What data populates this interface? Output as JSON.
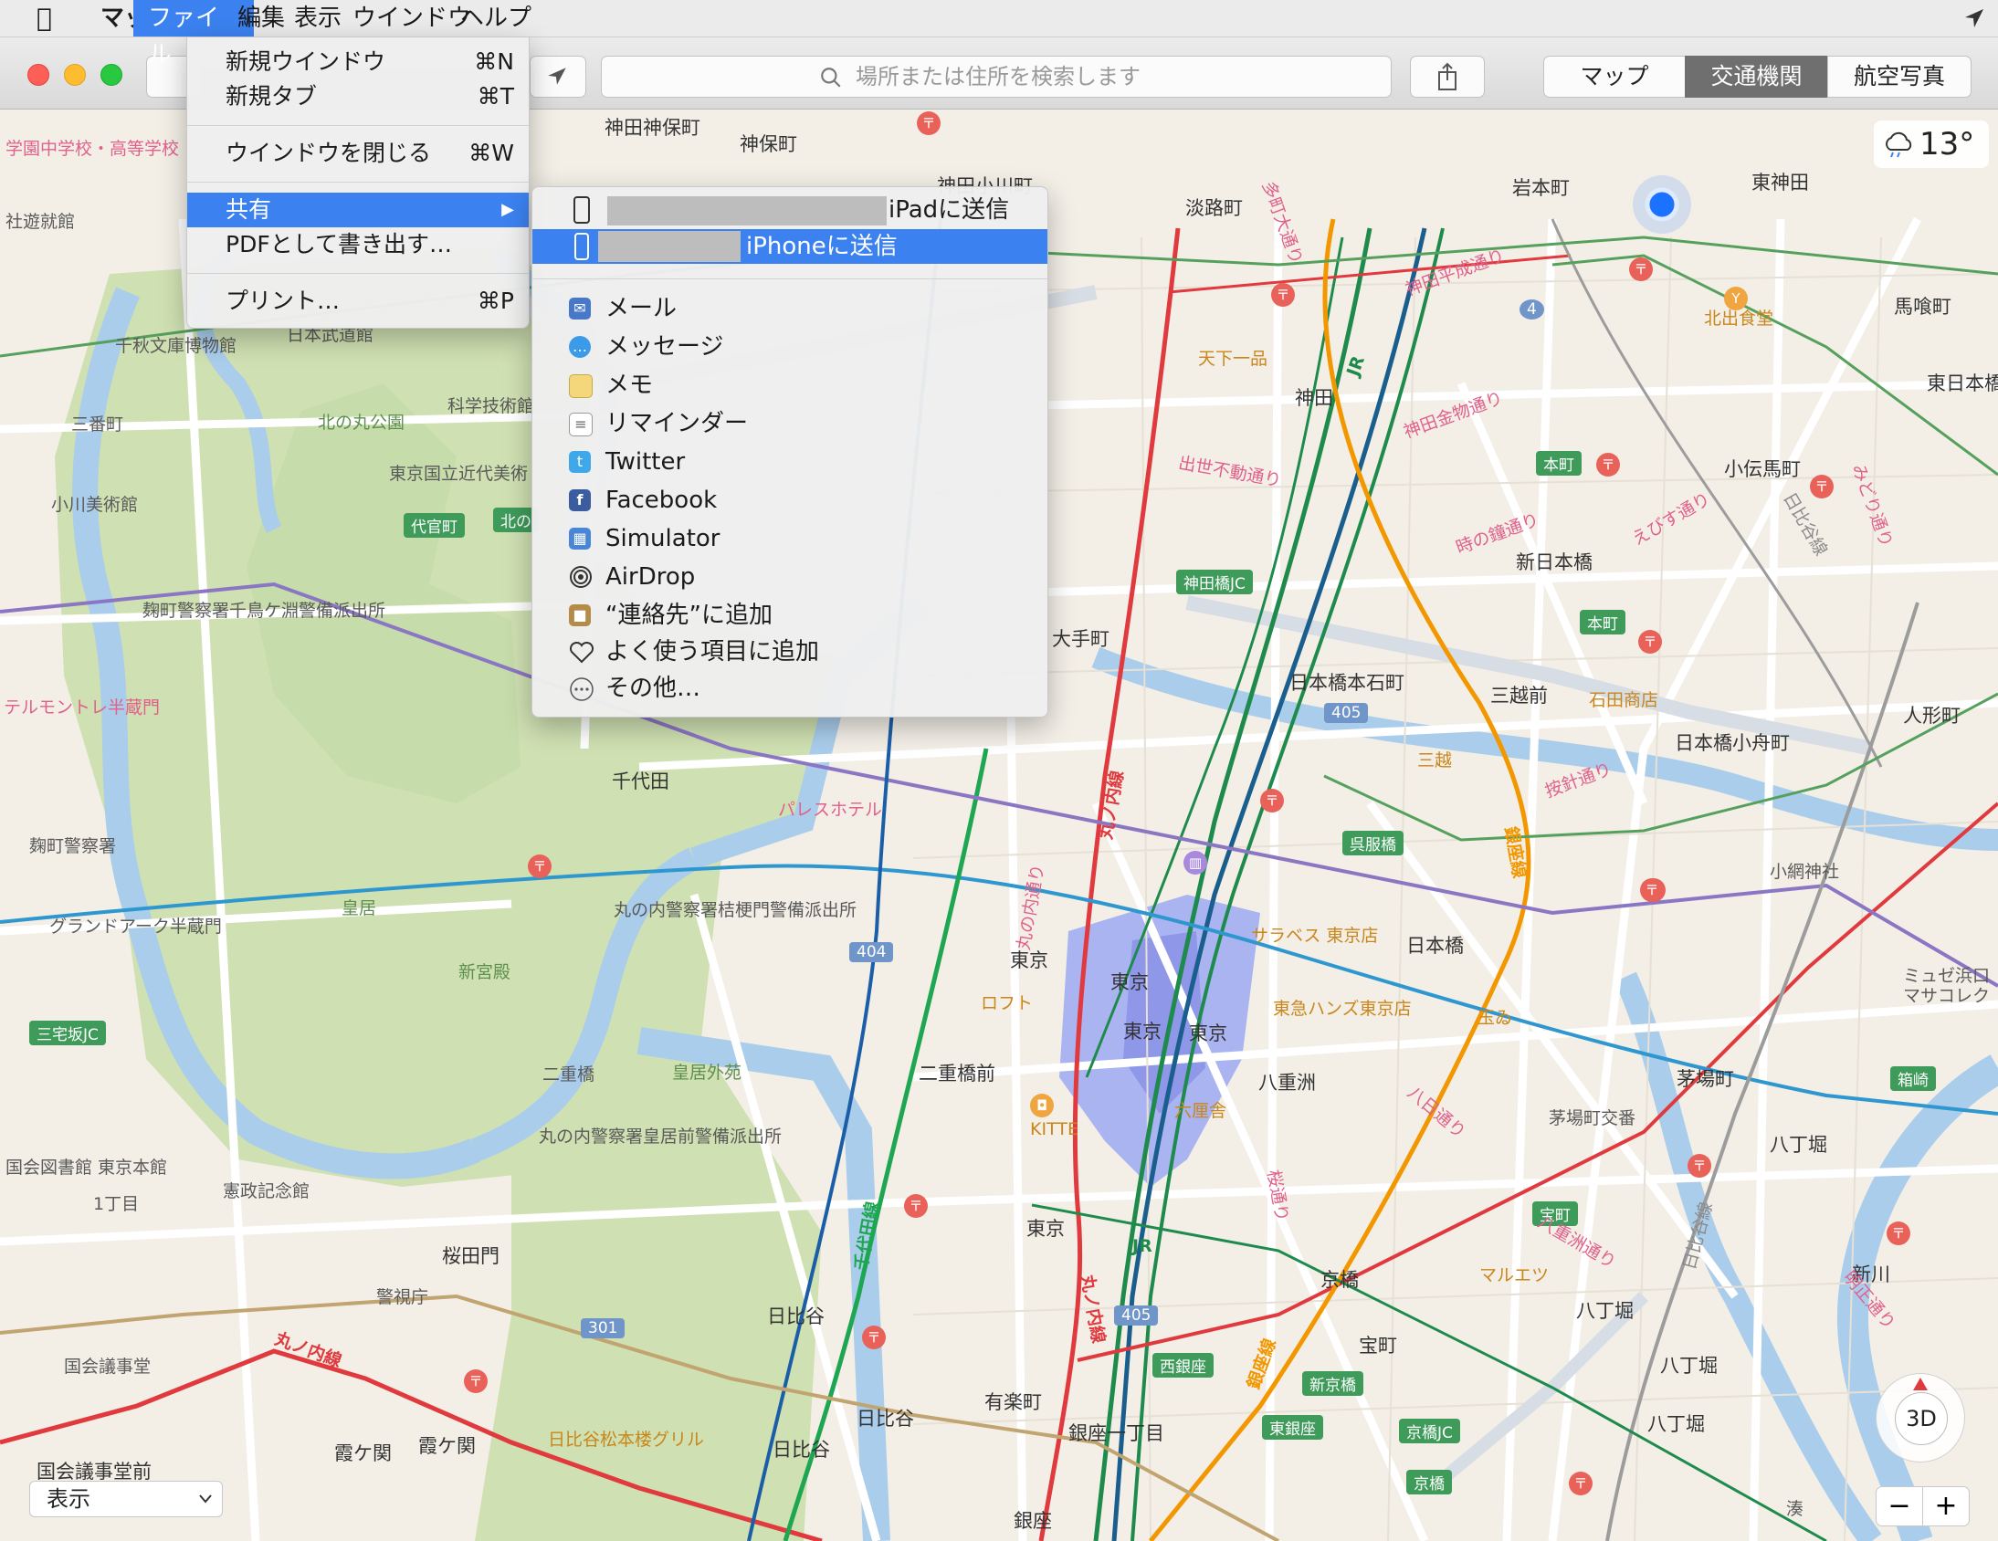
{
  "menubar": {
    "apple": "",
    "items": [
      "マップ",
      "ファイル",
      "編集",
      "表示",
      "ウインドウ",
      "ヘルプ"
    ],
    "status_icon": "location-arrow"
  },
  "toolbar": {
    "search_placeholder": "場所または住所を検索します",
    "segments": [
      "マップ",
      "交通機関",
      "航空写真"
    ],
    "selected_segment": "交通機関"
  },
  "weather": {
    "temp": "13°"
  },
  "file_menu": {
    "items": [
      {
        "label": "新規ウインドウ",
        "shortcut": "⌘N"
      },
      {
        "label": "新規タブ",
        "shortcut": "⌘T"
      },
      {
        "label": "ウインドウを閉じる",
        "shortcut": "⌘W"
      },
      {
        "label": "共有",
        "shortcut": "▶"
      },
      {
        "label": "PDFとして書き出す…",
        "shortcut": ""
      },
      {
        "label": "プリント…",
        "shortcut": "⌘P"
      }
    ]
  },
  "share_menu": {
    "ipad": "iPadに送信",
    "iphone": "iPhoneに送信",
    "items": [
      {
        "label": "メール",
        "icon": "mail-icon",
        "color": "#4a78c8"
      },
      {
        "label": "メッセージ",
        "icon": "messages-icon",
        "color": "#3c9be8"
      },
      {
        "label": "メモ",
        "icon": "notes-icon",
        "color": "#f3d77a"
      },
      {
        "label": "リマインダー",
        "icon": "reminders-icon",
        "color": "#ffffff"
      },
      {
        "label": "Twitter",
        "icon": "twitter-icon",
        "color": "#3fa8e8"
      },
      {
        "label": "Facebook",
        "icon": "facebook-icon",
        "color": "#3b5c9e"
      },
      {
        "label": "Simulator",
        "icon": "simulator-icon",
        "color": "#4a86d8"
      },
      {
        "label": "AirDrop",
        "icon": "airdrop-icon",
        "color": "#ffffff"
      },
      {
        "label": "“連絡先”に追加",
        "icon": "contacts-icon",
        "color": "#b58b48"
      },
      {
        "label": "よく使う項目に追加",
        "icon": "heart-icon",
        "color": "#ffffff"
      },
      {
        "label": "その他…",
        "icon": "more-icon",
        "color": "#ffffff"
      }
    ]
  },
  "map_labels": {
    "kanda_jinbocho": "神田神保町",
    "jinbocho": "神保町",
    "kanda_ogawamachi": "神田小川町",
    "awajicho": "淡路町",
    "iwamotocho": "岩本町",
    "higashi_kanda": "東神田",
    "bakurocho": "馬喰町",
    "higashi_nihonbashi": "東日本橋",
    "kitade": "北出食堂",
    "tenka": "天下一品",
    "kanda": "神田",
    "kodenmacho": "小伝馬町",
    "shinnihonbashi": "新日本橋",
    "otemachi": "大手町",
    "nihonbashi_hongoku": "日本橋本石町",
    "mitsukoshimae": "三越前",
    "ishida": "石田商店",
    "ningyocho": "人形町",
    "nihonbashi_kobuna": "日本橋小舟町",
    "mitsukoshi": "三越",
    "chiyoda": "千代田",
    "palace_hotel": "パレスホテル",
    "kokyo": "皇居",
    "shinkyuden": "新宮殿",
    "kokyogaien": "皇居外苑",
    "nijubashimae": "二重橋前",
    "tokyo": "東京",
    "nihonbashi": "日本橋",
    "kayabacho": "茅場町",
    "hatchobori": "八丁堀",
    "yaesu": "八重洲",
    "kyobashi": "京橋",
    "takaracho": "宝町",
    "yurakucho": "有楽町",
    "ginza_itchome": "銀座一丁目",
    "ginza": "銀座",
    "hibiya": "日比谷",
    "sakuradamon": "桜田門",
    "keishicho": "警視庁",
    "kokkai": "国会議事堂",
    "kokkai_mae": "国会議事堂前",
    "kasumigaseki": "霞ケ関",
    "kitanomaru": "北の丸公園",
    "sanbancho": "三番町",
    "kitte": "KITTE",
    "sarabeth": "サラベス 東京店",
    "tokyu_hands": "東急ハンズ東京店",
    "rokurinsha": "六厘舎",
    "loft": "ロフト",
    "maruetsu": "マルエツ",
    "shinkawa": "新川",
    "koami": "小網神社",
    "museum": "ミュゼ浜口\nマサコレク",
    "tamaya": "玉ゐ",
    "hibiya_grill": "日比谷松本楼グリル",
    "kenseikinen": "憲政記念館",
    "kojimachi": "麹町警察署",
    "grandark": "グランドアーク半蔵門",
    "hanzomon": "テルモントレ半蔵門",
    "chiaki": "千秋文庫博物館",
    "budokan": "日本武道館",
    "ogawa": "小川美術館",
    "gakuen": "学園中学校・高等学校",
    "shayukan": "社遊就館",
    "kagaku": "科学技術館",
    "kindai": "東京国立近代美術",
    "kojimachi_police": "麹町警察署千鳥ケ淵警備派出所",
    "marunouchi_kikyo": "丸の内警察署桔梗門警備派出所",
    "marunouchi_kokyo": "丸の内警察署皇居前警備派出所",
    "nijubashi": "二重橋",
    "kokkai_tosho": "国会図書館 東京本館",
    "itchome": "1丁目",
    "kayabacho_koban": "茅場町交番",
    "minato": "湊",
    "hatchobori2": "八丁堀"
  },
  "road_shields": [
    "代官町",
    "北の",
    "神田橋JC",
    "本町",
    "本町",
    "呉服橋",
    "西銀座",
    "新京橋",
    "東銀座",
    "京橋JC",
    "京橋",
    "宝町",
    "箱崎",
    "三宅坂JC"
  ],
  "route_numbers": [
    "4",
    "405",
    "404",
    "301",
    "405"
  ],
  "lines": [
    "JR",
    "JR",
    "丸ノ内線",
    "丸ノ内線",
    "丸ノ内線",
    "千代田線",
    "銀座線",
    "銀座線",
    "日比谷線",
    "日比谷線",
    "みどり通り",
    "えびす通り",
    "時の鐘通り",
    "神田金物通り",
    "神田平成通り",
    "出世不動通り",
    "八重洲通り",
    "八日通り",
    "丸の内通り",
    "明正通り",
    "多町大通り",
    "按針通り",
    "桜通り"
  ],
  "bottom": {
    "display_select": "表示",
    "zoom_minus": "−",
    "zoom_plus": "+",
    "three_d": "3D"
  }
}
